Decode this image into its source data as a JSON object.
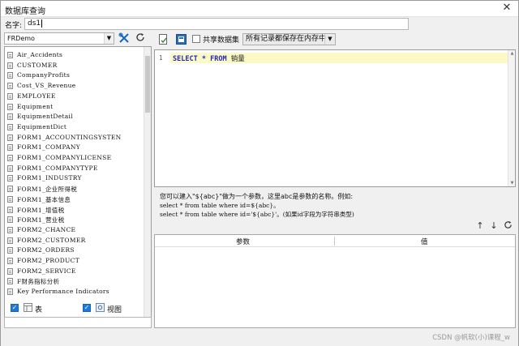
{
  "window": {
    "title": "数据库查询",
    "close_glyph": "✕"
  },
  "name_row": {
    "label": "名字:",
    "value": "ds1"
  },
  "left": {
    "datasource": "FRDemo",
    "tables": [
      "Air_Accidents",
      "CUSTOMER",
      "CompanyProfits",
      "Cost_VS_Revenue",
      "EMPLOYEE",
      "Equipment",
      "EquipmentDetail",
      "EquipmentDict",
      "FORM1_ACCOUNTINGSYSTEN",
      "FORM1_COMPANY",
      "FORM1_COMPANYLICENSE",
      "FORM1_COMPANYTYPE",
      "FORM1_INDUSTRY",
      "FORM1_企业所得税",
      "FORM1_基本信息",
      "FORM1_增值税",
      "FORM1_营业税",
      "FORM2_CHANCE",
      "FORM2_CUSTOMER",
      "FORM2_ORDERS",
      "FORM2_PRODUCT",
      "FORM2_SERVICE",
      "F财务指标分析",
      "Key Performance Indicators"
    ],
    "filter": {
      "tables_label": "表",
      "views_label": "视图"
    }
  },
  "toolbar": {
    "share_label": "共享数据集",
    "cache_option": "所有记录都保存在内存中"
  },
  "editor": {
    "line_number": "1",
    "kw_select": "SELECT",
    "star": "*",
    "kw_from": "FROM",
    "table": "销量"
  },
  "hint": {
    "line1": "您可以建入\"${abc}\"做为一个参数，这里abc是参数的名称。例如:",
    "line2": "select * from table where id=${abc}。",
    "line3": "select * from table where id='${abc}'。(如果id字段为字符串类型)"
  },
  "param_table": {
    "col_param": "参数",
    "col_value": "值"
  },
  "watermark": "CSDN @帆软(小)课程_w"
}
